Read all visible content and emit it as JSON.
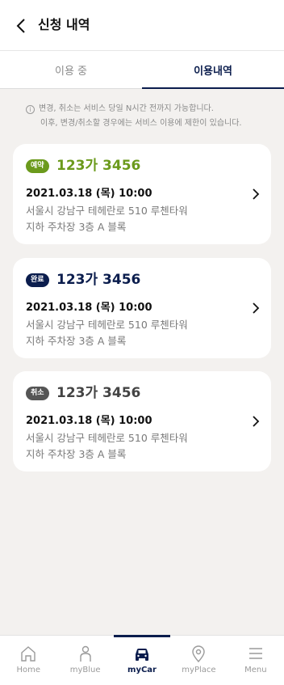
{
  "header": {
    "title": "신청 내역"
  },
  "tabs": [
    {
      "label": "이용 중",
      "active": false
    },
    {
      "label": "이용내역",
      "active": true
    }
  ],
  "notice": {
    "line1": "변경, 취소는 서비스 당일 N시간 전까지 가능합니다.",
    "line2": "이후, 변경/취소할 경우에는 서비스 이용에 제한이 있습니다."
  },
  "cards": [
    {
      "badge": "예약",
      "badge_color": "#6b9a1c",
      "plate": "123가 3456",
      "plate_color": "#6b9a1c",
      "datetime": "2021.03.18 (목) 10:00",
      "address1": "서울시 강남구 테헤란로 510 루첸타워",
      "address2": "지하 주차장 3층 A 블록"
    },
    {
      "badge": "완료",
      "badge_color": "#0b1d4d",
      "plate": "123가 3456",
      "plate_color": "#0b1d4d",
      "datetime": "2021.03.18 (목) 10:00",
      "address1": "서울시 강남구 테헤란로 510 루첸타워",
      "address2": "지하 주차장 3층 A 블록"
    },
    {
      "badge": "취소",
      "badge_color": "#555555",
      "plate": "123가 3456",
      "plate_color": "#444444",
      "datetime": "2021.03.18 (목) 10:00",
      "address1": "서울시 강남구 테헤란로 510 루첸타워",
      "address2": "지하 주차장 3층 A 블록"
    }
  ],
  "bottom_nav": [
    {
      "label": "Home",
      "icon": "home-icon",
      "active": false
    },
    {
      "label": "myBlue",
      "icon": "person-icon",
      "active": false
    },
    {
      "label": "myCar",
      "icon": "car-icon",
      "active": true
    },
    {
      "label": "myPlace",
      "icon": "location-pin-icon",
      "active": false
    },
    {
      "label": "Menu",
      "icon": "hamburger-menu-icon",
      "active": false
    }
  ]
}
